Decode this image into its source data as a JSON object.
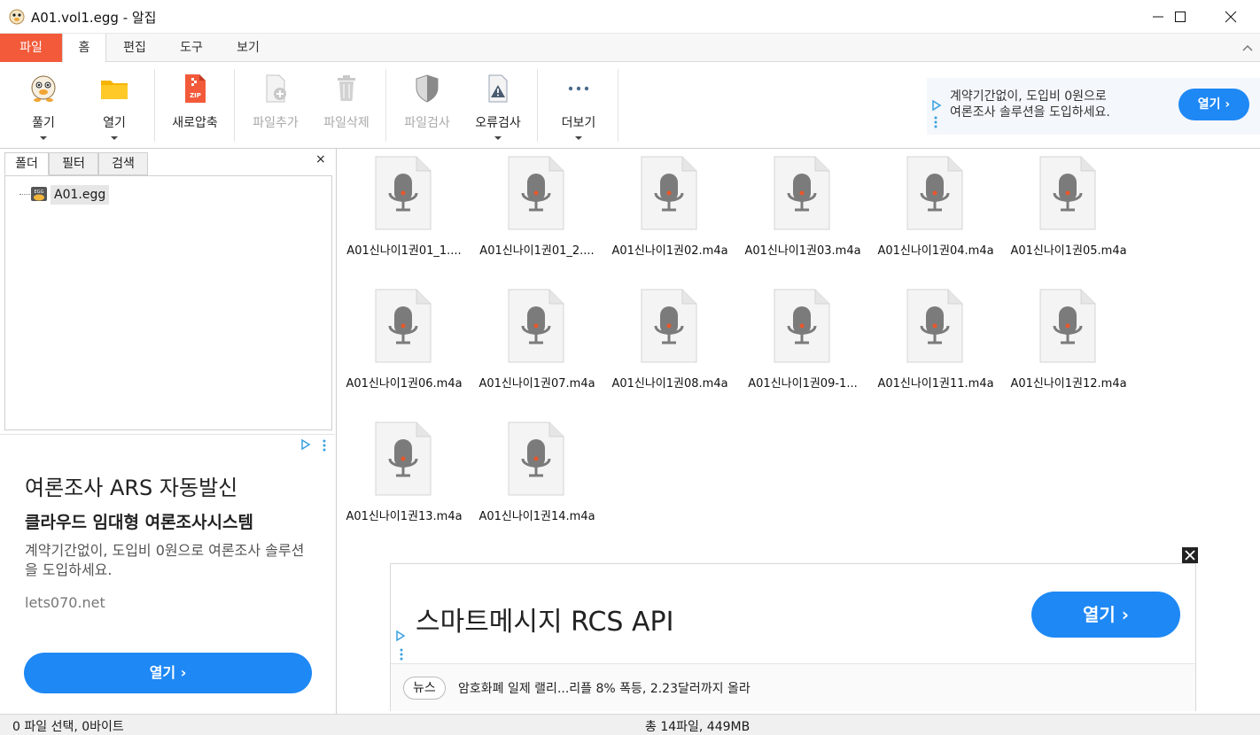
{
  "window": {
    "title": "A01.vol1.egg - 알집",
    "app_icon": "alzip-mascot-icon"
  },
  "ribbon_tabs": [
    "파일",
    "홈",
    "편집",
    "도구",
    "보기"
  ],
  "ribbon": {
    "buttons": [
      {
        "label": "풀기",
        "icon": "extract-mascot-icon",
        "enabled": true,
        "dropdown": true
      },
      {
        "label": "열기",
        "icon": "folder-icon",
        "enabled": true,
        "dropdown": true
      },
      {
        "label": "새로압축",
        "icon": "zip-file-icon",
        "enabled": true,
        "dropdown": false
      },
      {
        "label": "파일추가",
        "icon": "add-file-icon",
        "enabled": false,
        "dropdown": false
      },
      {
        "label": "파일삭제",
        "icon": "trash-icon",
        "enabled": false,
        "dropdown": false
      },
      {
        "label": "파일검사",
        "icon": "shield-icon",
        "enabled": false,
        "dropdown": false
      },
      {
        "label": "오류검사",
        "icon": "warning-file-icon",
        "enabled": true,
        "dropdown": true
      },
      {
        "label": "더보기",
        "icon": "more-icon",
        "enabled": true,
        "dropdown": true
      }
    ]
  },
  "top_ad": {
    "line1": "계약기간없이, 도입비 0원으로",
    "line2": "여론조사 솔루션을 도입하세요.",
    "button": "열기 ›"
  },
  "left_panel": {
    "tabs": [
      "폴더",
      "필터",
      "검색"
    ],
    "close": "×",
    "tree_root": "A01.egg"
  },
  "left_ad": {
    "headline": "여론조사 ARS 자동발신",
    "subheadline": "클라우드 임대형 여론조사시스템",
    "body": "계약기간없이, 도입비 0원으로 여론조사 솔루션을 도입하세요.",
    "url": "lets070.net",
    "button": "열기 ›"
  },
  "files": [
    "A01신나이1권01_1....",
    "A01신나이1권01_2....",
    "A01신나이1권02.m4a",
    "A01신나이1권03.m4a",
    "A01신나이1권04.m4a",
    "A01신나이1권05.m4a",
    "A01신나이1권06.m4a",
    "A01신나이1권07.m4a",
    "A01신나이1권08.m4a",
    "A01신나이1권09-1...",
    "A01신나이1권11.m4a",
    "A01신나이1권12.m4a",
    "A01신나이1권13.m4a",
    "A01신나이1권14.m4a"
  ],
  "bottom_ad": {
    "headline": "스마트메시지 RCS API",
    "button": "열기 ›",
    "news_tag": "뉴스",
    "news_text": "암호화폐 일제 랠리...리플 8% 폭등, 2.23달러까지 올라"
  },
  "status": {
    "selection": "0 파일 선택,  0바이트",
    "total": "총 14파일,  449MB"
  },
  "colors": {
    "file_tab": "#f25a3a",
    "ad_button": "#1e88f5"
  }
}
